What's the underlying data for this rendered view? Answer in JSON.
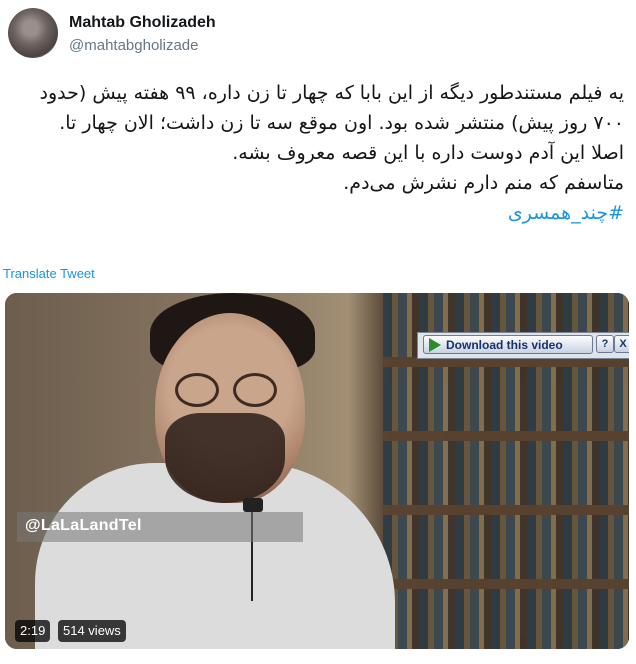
{
  "author": {
    "display_name": "Mahtab Gholizadeh",
    "handle": "@mahtabgholizade",
    "avatar_icon": "profile-photo"
  },
  "tweet": {
    "lines": [
      "یه فیلم مستندطور دیگه از این بابا که چهار تا زن داره، ۹۹ هفته پیش (حدود",
      "۷۰۰ روز پیش) منتشر شده بود. اون موقع سه تا زن داشت؛ الان چهار تا.",
      "اصلا این آدم دوست داره با این قصه معروف بشه.",
      "متاسفم که منم دارم نشرش می‌دم."
    ],
    "hashtag": "#چند_همسری",
    "translate_label": "Translate Tweet"
  },
  "media": {
    "watermark": "@LaLaLandTel",
    "download_label": "Download this video",
    "help_label": "?",
    "close_label": "X",
    "duration": "2:19",
    "views": "514 views"
  },
  "colors": {
    "link": "#1b95e0",
    "text": "#14171a",
    "secondary": "#657786"
  }
}
